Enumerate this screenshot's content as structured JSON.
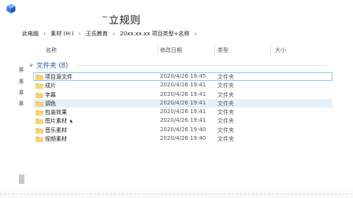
{
  "page": {
    "title": "立规则"
  },
  "breadcrumb": [
    "此电脑",
    "素材 (H:)",
    "王氏教育",
    "20xx.xx.xx 项目类型+名称"
  ],
  "columns": {
    "name": "名称",
    "date": "修改日期",
    "type": "类型",
    "size": "大小"
  },
  "group": {
    "label": "文件夹 (8)"
  },
  "rows": [
    {
      "name": "项目源文件",
      "date": "2020/4/26 19:45",
      "type": "文件夹"
    },
    {
      "name": "成片",
      "date": "2020/4/26 19:41",
      "type": "文件夹"
    },
    {
      "name": "字幕",
      "date": "2020/4/26 19:41",
      "type": "文件夹"
    },
    {
      "name": "调色",
      "date": "2020/4/26 19:41",
      "type": "文件夹"
    },
    {
      "name": "包装效果",
      "date": "2020/4/26 19:41",
      "type": "文件夹"
    },
    {
      "name": "图片素材",
      "date": "2020/4/26 19:41",
      "type": "文件夹"
    },
    {
      "name": "音乐素材",
      "date": "2020/4/26 19:40",
      "type": "文件夹"
    },
    {
      "name": "视频素材",
      "date": "2020/4/26 19:40",
      "type": "文件夹"
    }
  ],
  "icons": {
    "folder": "folder-icon",
    "pin": "pin-icon",
    "chevron": "chevron-down-icon",
    "crumb_separator": "chevron-right-icon"
  },
  "colors": {
    "accent": "#1e5aa8",
    "folder": "#f4c35a",
    "hover": "#e5f1fb",
    "focus_border": "#99c9ef"
  }
}
